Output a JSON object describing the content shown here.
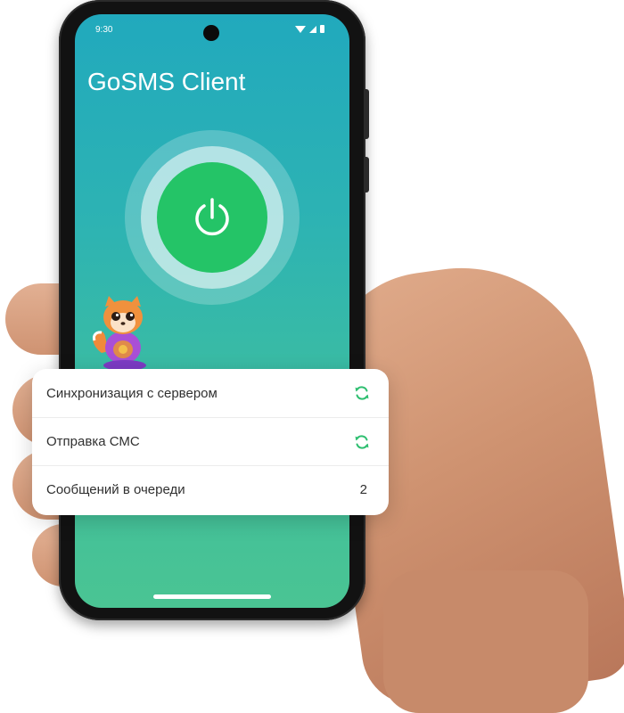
{
  "status_bar": {
    "time": "9:30"
  },
  "app": {
    "title": "GoSMS Client"
  },
  "power_button": {
    "state": "on",
    "color": "#24c467"
  },
  "status_card": {
    "rows": [
      {
        "label": "Синхронизация с сервером",
        "icon": "sync-icon"
      },
      {
        "label": "Отправка СМС",
        "icon": "sync-icon"
      },
      {
        "label": "Сообщений в очереди",
        "value": "2"
      }
    ]
  },
  "colors": {
    "screen_top": "#21a9bd",
    "screen_bottom": "#4ac493",
    "accent_green": "#24c467",
    "sync_icon": "#2fbf71"
  }
}
